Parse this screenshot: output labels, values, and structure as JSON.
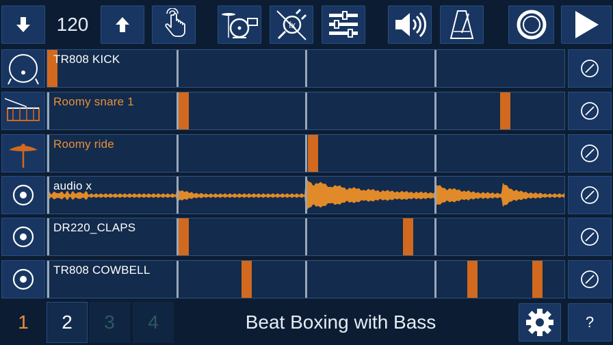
{
  "transport": {
    "tempo": "120",
    "tempo_down_icon": "arrow-down-icon",
    "tempo_up_icon": "arrow-up-icon",
    "tap_icon": "hand-tap-icon",
    "drumkit_icon": "drum-kit-icon",
    "fx_icon": "fx-plug-icon",
    "mixer_icon": "mixer-sliders-icon",
    "volume_icon": "speaker-icon",
    "metronome_icon": "metronome-icon",
    "record_icon": "record-icon",
    "play_icon": "play-icon"
  },
  "tracks": [
    {
      "label": "TR808 KICK",
      "label_color": "#ffffff",
      "icon": "kick-drum-icon",
      "hits": [
        0.0
      ]
    },
    {
      "label": "Roomy snare 1",
      "label_color": "#e8903a",
      "icon": "snare-drum-icon",
      "hits": [
        0.25,
        0.875
      ]
    },
    {
      "label": "Roomy ride",
      "label_color": "#e8903a",
      "icon": "cymbal-icon",
      "hits": [
        0.5
      ]
    },
    {
      "label": "audio x",
      "label_color": "#ffffff",
      "icon": "audio-track-icon",
      "hits": []
    },
    {
      "label": "DR220_CLAPS",
      "label_color": "#ffffff",
      "icon": "audio-track-icon",
      "hits": [
        0.25,
        0.6875
      ]
    },
    {
      "label": "TR808 COWBELL",
      "label_color": "#ffffff",
      "icon": "audio-track-icon",
      "hits": [
        0.375,
        0.8125,
        0.9375
      ]
    }
  ],
  "pages": [
    {
      "label": "1",
      "color": "#e8903a"
    },
    {
      "label": "2",
      "color": "#ffffff"
    },
    {
      "label": "3",
      "color": "#2b5a5e"
    },
    {
      "label": "4",
      "color": "#2b5a5e"
    }
  ],
  "song_title": "Beat Boxing with Bass",
  "settings_icon": "gear-icon",
  "help_label": "?",
  "colors": {
    "background": "#0c1d33",
    "button": "#183661",
    "lane": "#132b4c",
    "accent": "#d2691e",
    "wave": "#e08a2a"
  }
}
